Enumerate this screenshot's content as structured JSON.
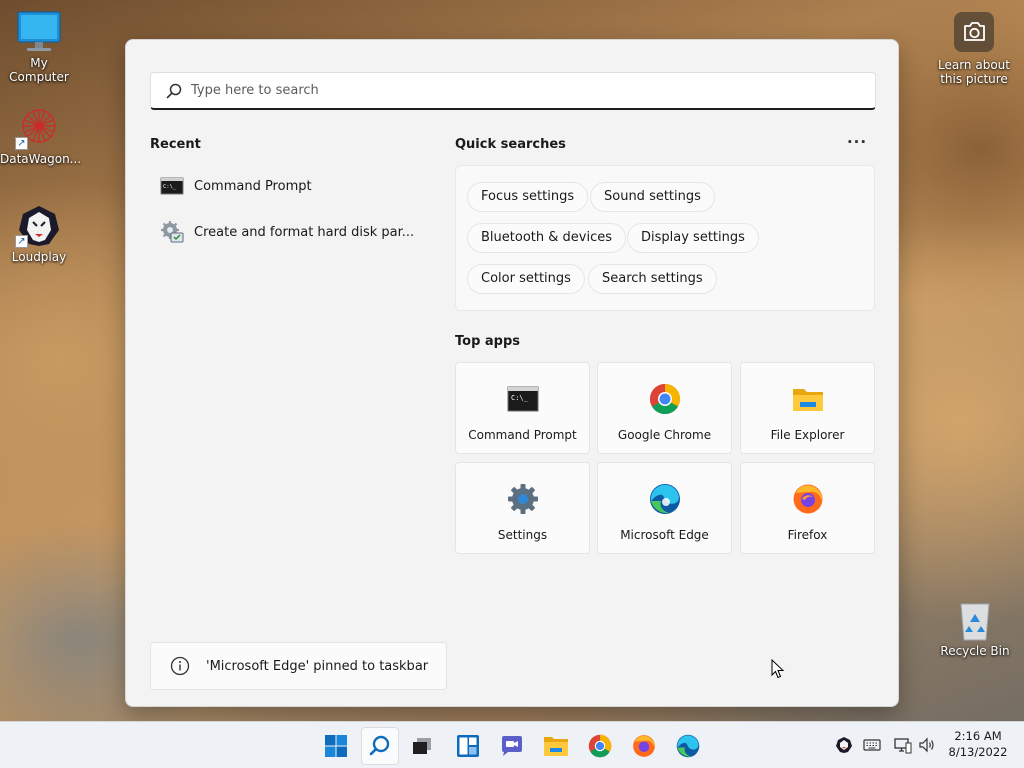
{
  "desktop": {
    "icons": [
      {
        "label": "My Computer",
        "icon": "monitor-icon"
      },
      {
        "label": "DataWagon...",
        "icon": "datawagon-icon"
      },
      {
        "label": "Loudplay",
        "icon": "loudplay-lion-icon"
      },
      {
        "label": "Recycle Bin",
        "icon": "recycle-bin-icon"
      }
    ],
    "learn": {
      "line1": "Learn about",
      "line2": "this picture",
      "icon": "camera-icon"
    }
  },
  "start": {
    "search": {
      "placeholder": "Type here to search",
      "value": "",
      "icon": "search-icon"
    },
    "recent": {
      "title": "Recent",
      "items": [
        {
          "label": "Command Prompt",
          "icon": "command-prompt-icon"
        },
        {
          "label": "Create and format hard disk par...",
          "icon": "disk-management-icon"
        }
      ]
    },
    "quick": {
      "title": "Quick searches",
      "more": "···",
      "chips": [
        "Focus settings",
        "Sound settings",
        "Bluetooth & devices",
        "Display settings",
        "Color settings",
        "Search settings"
      ]
    },
    "top_apps": {
      "title": "Top apps",
      "apps": [
        {
          "label": "Command Prompt",
          "icon": "command-prompt-icon"
        },
        {
          "label": "Google Chrome",
          "icon": "chrome-icon"
        },
        {
          "label": "File Explorer",
          "icon": "folder-icon"
        },
        {
          "label": "Settings",
          "icon": "gear-icon"
        },
        {
          "label": "Microsoft Edge",
          "icon": "edge-icon"
        },
        {
          "label": "Firefox",
          "icon": "firefox-icon"
        }
      ]
    },
    "notice": {
      "text": "'Microsoft Edge' pinned to taskbar",
      "icon": "info-icon"
    }
  },
  "taskbar": {
    "buttons": [
      "windows-start-icon",
      "search-icon",
      "task-view-icon",
      "widgets-icon",
      "chat-icon",
      "file-explorer-icon",
      "chrome-icon",
      "firefox-icon",
      "edge-icon"
    ],
    "tray": [
      "loudplay-icon",
      "keyboard-icon",
      "network-icon",
      "volume-icon"
    ],
    "time": "2:16 AM",
    "date": "8/13/2022"
  },
  "colors": {
    "accent": "#0067c0",
    "panel": "#f3f3f3",
    "taskbar": "#eef2f6"
  }
}
